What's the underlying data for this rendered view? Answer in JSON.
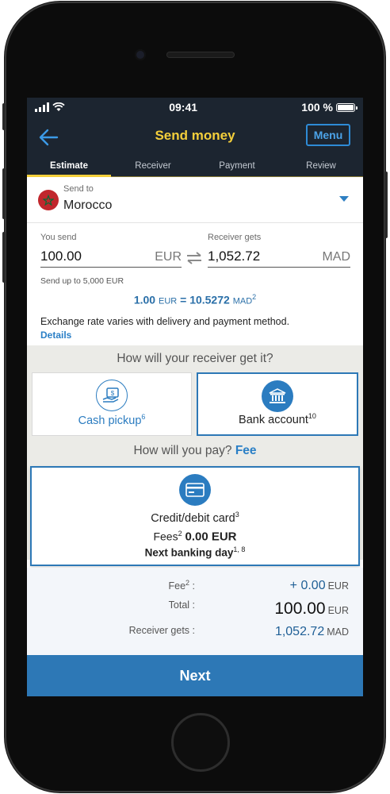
{
  "status_bar": {
    "time": "09:41",
    "battery": "100 %"
  },
  "app_bar": {
    "title": "Send money",
    "menu_label": "Menu"
  },
  "tabs": [
    {
      "label": "Estimate",
      "active": true
    },
    {
      "label": "Receiver",
      "active": false
    },
    {
      "label": "Payment",
      "active": false
    },
    {
      "label": "Review",
      "active": false
    }
  ],
  "send_to": {
    "label": "Send to",
    "country": "Morocco"
  },
  "amounts": {
    "you_send_label": "You send",
    "you_send_value": "100.00",
    "you_send_currency": "EUR",
    "receiver_gets_label": "Receiver gets",
    "receiver_gets_value": "1,052.72",
    "receiver_gets_currency": "MAD",
    "send_up_to": "Send up to  5,000  EUR",
    "rate_left": "1.00",
    "rate_left_cur": "EUR",
    "rate_eq": "=",
    "rate_right": "10.5272",
    "rate_right_cur": "MAD",
    "rate_sup": "2",
    "exchange_note": "Exchange rate varies with delivery and payment method.",
    "details_link": "Details"
  },
  "delivery": {
    "question": "How will your receiver get it?",
    "options": [
      {
        "label": "Cash pickup",
        "sup": "6",
        "selected": false
      },
      {
        "label": "Bank account",
        "sup": "10",
        "selected": true
      }
    ]
  },
  "payment": {
    "question": "How will you pay?",
    "fee_link": "Fee",
    "method": "Credit/debit card",
    "method_sup": "3",
    "fees_label": "Fees",
    "fees_sup": "2",
    "fees_value": "0.00 EUR",
    "timing": "Next banking day",
    "timing_sup": "1, 8"
  },
  "summary": {
    "fee_label": "Fee",
    "fee_sup": "2",
    "fee_value": "+ 0.00",
    "fee_currency": "EUR",
    "total_label": "Total :",
    "total_value": "100.00",
    "total_currency": "EUR",
    "receiver_label": "Receiver gets :",
    "receiver_value": "1,052.72",
    "receiver_currency": "MAD"
  },
  "next_button": "Next",
  "colors": {
    "header_bg": "#1c2530",
    "accent_yellow": "#f4cf3b",
    "primary_blue": "#2d78b6",
    "flag_red": "#c1272d",
    "flag_star": "#0a6b34"
  },
  "icons": [
    "back-arrow-icon",
    "chevron-down-icon",
    "cash-hand-icon",
    "bank-icon",
    "credit-card-icon",
    "swap-arrows-icon",
    "wifi-icon",
    "signal-icon",
    "battery-icon"
  ]
}
